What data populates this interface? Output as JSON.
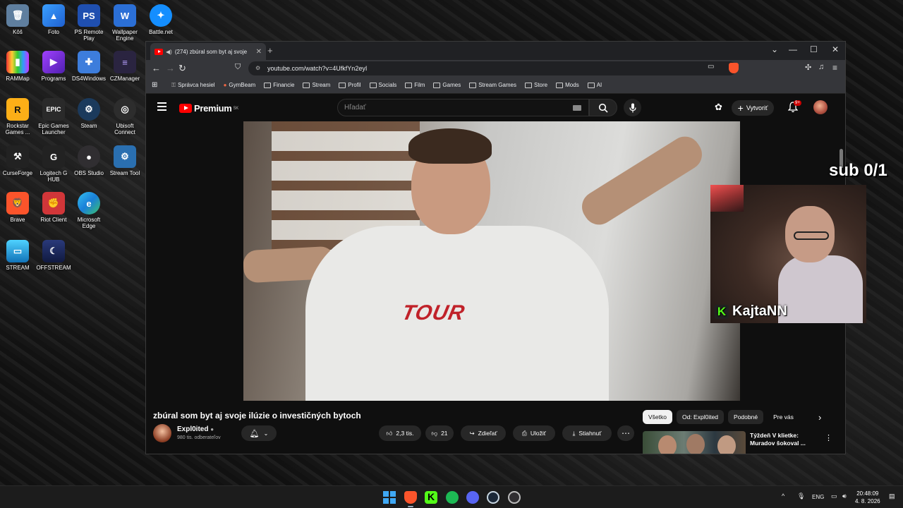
{
  "desktop": {
    "icons": [
      {
        "label": "Kôš",
        "glyph": "🗑"
      },
      {
        "label": "Foto",
        "glyph": "▲"
      },
      {
        "label": "PS Remote Play",
        "glyph": "PS"
      },
      {
        "label": "Wallpaper Engine",
        "glyph": "W"
      },
      {
        "label": "Battle.net",
        "glyph": "✦"
      },
      {
        "label": "RAMMap",
        "glyph": "▮"
      },
      {
        "label": "Programs",
        "glyph": "▶"
      },
      {
        "label": "DS4Windows",
        "glyph": "✚"
      },
      {
        "label": "CZManager",
        "glyph": "≡"
      },
      {
        "label": "Rockstar Games ...",
        "glyph": "R"
      },
      {
        "label": "Epic Games Launcher",
        "glyph": "EPIC"
      },
      {
        "label": "Steam",
        "glyph": "⚙"
      },
      {
        "label": "Ubisoft Connect",
        "glyph": "◎"
      },
      {
        "label": "CurseForge",
        "glyph": "⚒"
      },
      {
        "label": "Logitech G HUB",
        "glyph": "G"
      },
      {
        "label": "OBS Studio",
        "glyph": "●"
      },
      {
        "label": "Stream Tool",
        "glyph": "⚙"
      },
      {
        "label": "Brave",
        "glyph": "🦁"
      },
      {
        "label": "Riot Client",
        "glyph": "✊"
      },
      {
        "label": "Microsoft Edge",
        "glyph": "e"
      },
      {
        "label": "STREAM",
        "glyph": "▭"
      },
      {
        "label": "OFFSTREAM",
        "glyph": "☾"
      }
    ]
  },
  "browser": {
    "tab_title": "(274) zbúral som byt aj svoje",
    "new_tab": "+",
    "url": "youtube.com/watch?v=4UfkfYn2eyI",
    "window_controls": {
      "dropdown": "⌄",
      "minimize": "—",
      "maximize": "☐",
      "close": "✕"
    },
    "nav": {
      "back": "←",
      "forward": "→",
      "reload": "↻"
    },
    "bookmarks": [
      "Správca hesiel",
      "GymBeam",
      "Financie",
      "Stream",
      "Profil",
      "Socials",
      "Film",
      "Games",
      "Stream Games",
      "Store",
      "Mods",
      "AI"
    ]
  },
  "youtube": {
    "logo_text": "Premium",
    "logo_region": "SK",
    "search_placeholder": "Hľadať",
    "create_label": "Vytvoriť",
    "notif_count": "9+",
    "video_title": "zbúral som byt aj svoje ilúzie o investičných bytoch",
    "shirt_text": "TOUR",
    "channel": {
      "name": "Expl0ited",
      "subscribers": "980 tis. odberateľov"
    },
    "actions": {
      "likes": "2,3 tis.",
      "dislikes": "21",
      "share": "Zdieľať",
      "save": "Uložiť",
      "download": "Stiahnuť",
      "more": "⋯"
    },
    "chips": [
      "Všetko",
      "Od: Expl0ited",
      "Podobné",
      "Pre vás"
    ],
    "recommendation": {
      "title": "Týždeň V klietke: Muradov šokoval ..."
    }
  },
  "overlay": {
    "sub_goal": "sub 0/1",
    "streamer_name": "KajtaNN",
    "platform_glyph": "K"
  },
  "taskbar": {
    "lang": "ENG",
    "time": "20:48:09",
    "date": "4. 8. 2026",
    "tray_chevron": "^"
  },
  "colors": {
    "youtube_red": "#ff0000",
    "kick_green": "#53fc18",
    "brave_orange": "#fb542b"
  }
}
